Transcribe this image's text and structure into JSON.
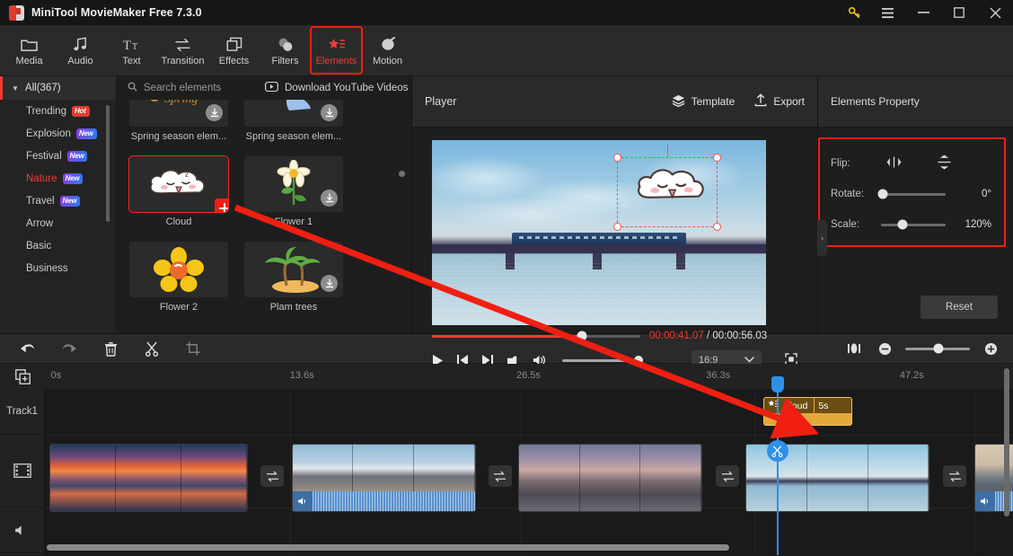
{
  "window": {
    "title": "MiniTool MovieMaker Free 7.3.0",
    "controls": {
      "key": "key-icon",
      "menu": "menu-icon",
      "minimize": "–",
      "maximize": "□",
      "close": "✕"
    }
  },
  "toolbar": {
    "items": [
      {
        "label": "Media",
        "icon": "folder-icon",
        "active": false
      },
      {
        "label": "Audio",
        "icon": "music-note-icon",
        "active": false
      },
      {
        "label": "Text",
        "icon": "text-icon",
        "active": false
      },
      {
        "label": "Transition",
        "icon": "transition-arrows-icon",
        "active": false
      },
      {
        "label": "Effects",
        "icon": "effects-layers-icon",
        "active": false
      },
      {
        "label": "Filters",
        "icon": "filters-circles-icon",
        "active": false
      },
      {
        "label": "Elements",
        "icon": "elements-star-icon",
        "active": true
      },
      {
        "label": "Motion",
        "icon": "motion-icon",
        "active": false
      }
    ]
  },
  "categories": {
    "all": {
      "label": "All(367)"
    },
    "items": [
      {
        "label": "Trending",
        "badge": "Hot",
        "badge_type": "hot",
        "selected": false
      },
      {
        "label": "Explosion",
        "badge": "New",
        "badge_type": "new",
        "selected": false
      },
      {
        "label": "Festival",
        "badge": "New",
        "badge_type": "new",
        "selected": false
      },
      {
        "label": "Nature",
        "badge": "New",
        "badge_type": "new",
        "selected": true
      },
      {
        "label": "Travel",
        "badge": "New",
        "badge_type": "new",
        "selected": false
      },
      {
        "label": "Arrow",
        "badge": "",
        "badge_type": "",
        "selected": false
      },
      {
        "label": "Basic",
        "badge": "",
        "badge_type": "",
        "selected": false
      },
      {
        "label": "Business",
        "badge": "",
        "badge_type": "",
        "selected": false
      }
    ]
  },
  "browser": {
    "search_placeholder": "Search elements",
    "youtube_label": "Download YouTube Videos",
    "elements": [
      {
        "name": "Spring season elem...",
        "downloadable": true,
        "selected": false,
        "thumb": "spring-text"
      },
      {
        "name": "Spring season elem...",
        "downloadable": true,
        "selected": false,
        "thumb": "blue-boot"
      },
      {
        "name": "Cloud",
        "downloadable": false,
        "selected": true,
        "thumb": "cloud-sticker"
      },
      {
        "name": "Flower 1",
        "downloadable": true,
        "selected": false,
        "thumb": "daisy"
      },
      {
        "name": "Flower 2",
        "downloadable": false,
        "selected": false,
        "thumb": "yellow-flower"
      },
      {
        "name": "Plam trees",
        "downloadable": true,
        "selected": false,
        "thumb": "palm-trees"
      }
    ]
  },
  "player": {
    "title": "Player",
    "template_label": "Template",
    "export_label": "Export",
    "current_time": "00:00:41.07",
    "separator": "/",
    "total_time": "00:00:56.03",
    "progress_percent": 72,
    "aspect_ratio": "16:9",
    "volume_percent": 100
  },
  "properties": {
    "title": "Elements Property",
    "flip_label": "Flip:",
    "flip_horizontal_icon": "flip-horizontal-icon",
    "flip_vertical_icon": "flip-vertical-icon",
    "rotate_label": "Rotate:",
    "rotate_value": "0°",
    "rotate_percent": 2,
    "scale_label": "Scale:",
    "scale_value": "120%",
    "scale_percent": 30,
    "reset_label": "Reset"
  },
  "timeline": {
    "tools": [
      {
        "name": "undo",
        "icon": "undo-arrow-icon",
        "enabled": true
      },
      {
        "name": "redo",
        "icon": "redo-arrow-icon",
        "enabled": false
      },
      {
        "name": "delete",
        "icon": "trash-icon",
        "enabled": true
      },
      {
        "name": "split",
        "icon": "scissors-icon",
        "enabled": true
      },
      {
        "name": "crop",
        "icon": "crop-icon",
        "enabled": true
      }
    ],
    "zoom_fit_icon": "fit-timeline-icon",
    "zoom_out_label": "−",
    "zoom_in_label": "+",
    "zoom_percent": 52,
    "ruler_ticks": [
      {
        "label": "0s",
        "left_percent": 0.5
      },
      {
        "label": "13.6s",
        "left_percent": 25.5
      },
      {
        "label": "26.5s",
        "left_percent": 48.9
      },
      {
        "label": "36.3s",
        "left_percent": 68.5
      },
      {
        "label": "47.2s",
        "left_percent": 88.5
      }
    ],
    "track_label": "Track1",
    "video_track_icon": "filmstrip-icon",
    "audio_track_icon": "audio-track-icon",
    "add_track_icon": "add-track-icon",
    "element_clip": {
      "label": "Cloud",
      "duration": "5s",
      "icon": "elements-star-icon"
    },
    "video_clips": [
      {
        "name": "beach-sunset-clip",
        "has_audio": false
      },
      {
        "name": "city-mountain-clip",
        "has_audio": true
      },
      {
        "name": "rocky-shore-clip",
        "has_audio": false
      },
      {
        "name": "bridge-train-clip",
        "has_audio": false
      },
      {
        "name": "horizon-clip",
        "has_audio": true
      }
    ],
    "transition_icon": "transition-arrows-icon",
    "split_playhead_icon": "scissors-icon"
  },
  "colors": {
    "accent_red": "#f01f12",
    "playhead_blue": "#2f90e8",
    "element_clip": "#e5a93a",
    "badge_hot": "#e03b2d"
  }
}
